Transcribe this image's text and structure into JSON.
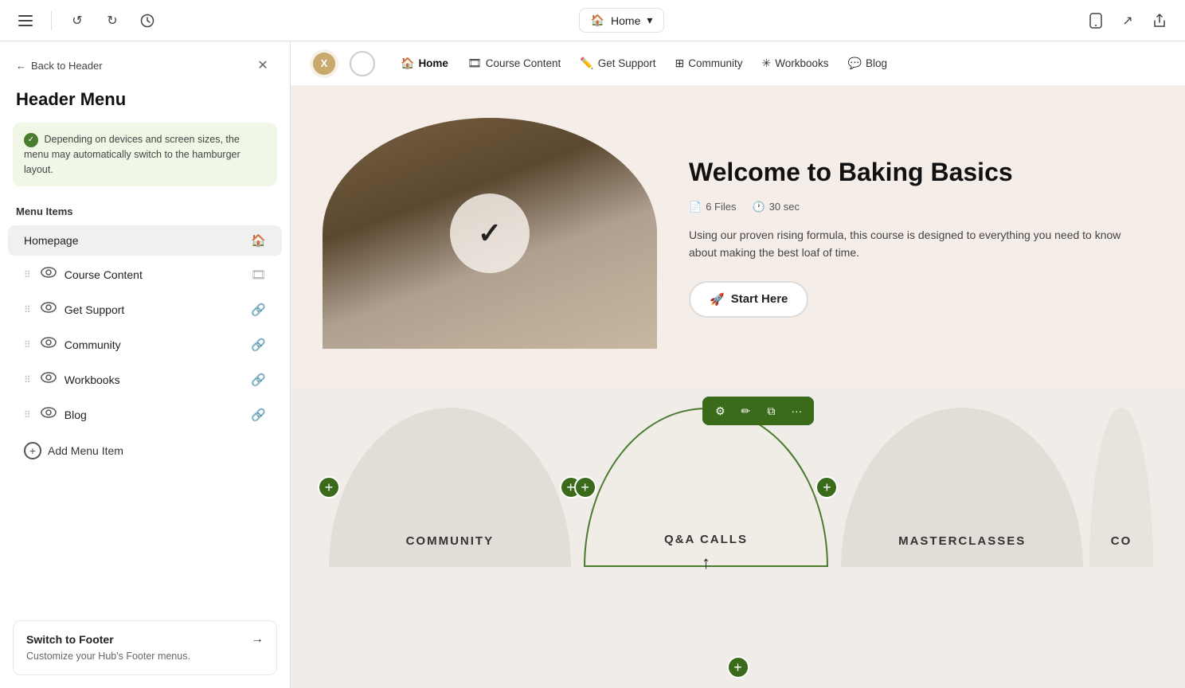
{
  "toolbar": {
    "undo_label": "↺",
    "redo_label": "↻",
    "history_label": "⏱",
    "home_label": "Home",
    "device_icon": "📱",
    "external_icon": "↗",
    "share_icon": "⬆"
  },
  "sidebar": {
    "back_label": "Back to Header",
    "title": "Header Menu",
    "info_text": "Depending on devices and screen sizes, the menu may automatically switch to the hamburger layout.",
    "section_label": "Menu Items",
    "items": [
      {
        "label": "Homepage",
        "icon": "🏠",
        "action_icon": "🏠"
      },
      {
        "label": "Course Content",
        "icon": "👁",
        "action_icon": "🎞"
      },
      {
        "label": "Get Support",
        "icon": "👁",
        "action_icon": "🔗"
      },
      {
        "label": "Community",
        "icon": "👁",
        "action_icon": "🔗"
      },
      {
        "label": "Workbooks",
        "icon": "👁",
        "action_icon": "🔗"
      },
      {
        "label": "Blog",
        "icon": "👁",
        "action_icon": "🔗"
      }
    ],
    "add_item_label": "Add Menu Item",
    "footer": {
      "title": "Switch to Footer",
      "description": "Customize your Hub's Footer menus.",
      "arrow": "→"
    }
  },
  "nav": {
    "home_label": "Home",
    "course_content_label": "Course Content",
    "get_support_label": "Get Support",
    "community_label": "Community",
    "workbooks_label": "Workbooks",
    "blog_label": "Blog"
  },
  "hero": {
    "title": "Welcome to Baking Basics",
    "files_label": "6 Files",
    "duration_label": "30 sec",
    "description": "Using our proven rising formula, this course is designed to everything you need to know about making the best loaf of time.",
    "start_btn": "Start Here"
  },
  "cards": [
    {
      "label": "COMMUNITY",
      "selected": false
    },
    {
      "label": "Q&A CALLS",
      "selected": true
    },
    {
      "label": "MASTERCLASSES",
      "selected": false
    },
    {
      "label": "CO",
      "selected": false,
      "truncated": true
    }
  ]
}
